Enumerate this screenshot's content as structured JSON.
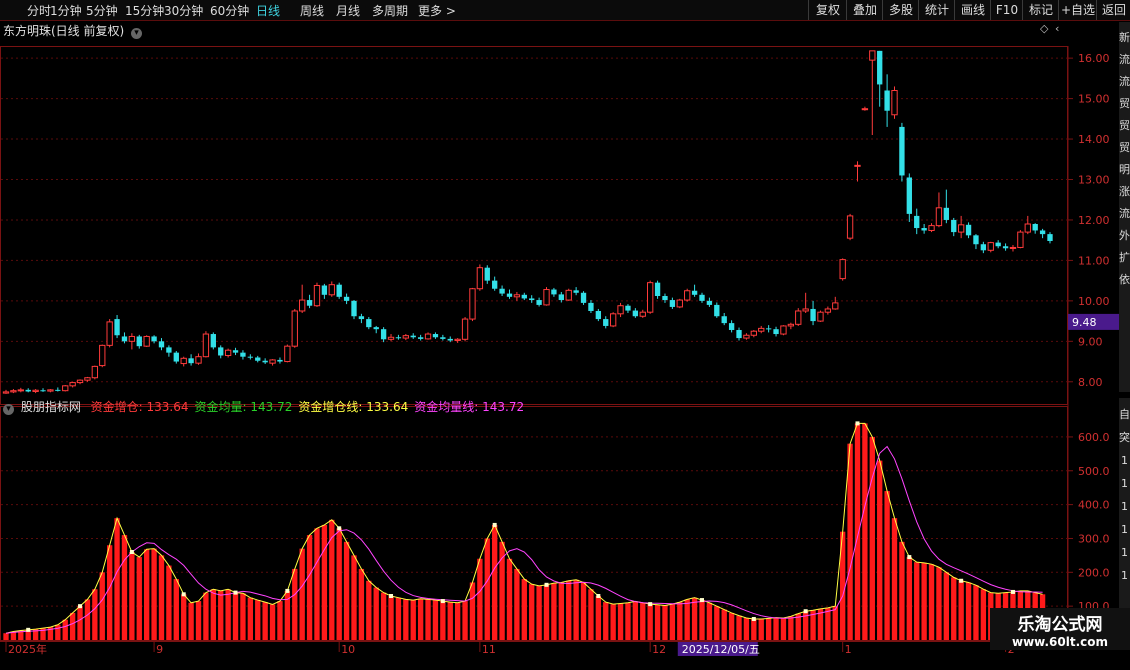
{
  "toolbar": {
    "left": [
      "分时",
      "1分钟",
      "5分钟",
      "15分钟",
      "30分钟",
      "60分钟",
      "日线",
      "周线",
      "月线",
      "多周期",
      "更多 >"
    ],
    "active": "日线",
    "right": [
      "复权",
      "叠加",
      "多股",
      "统计",
      "画线",
      "F10",
      "标记",
      "+自选",
      "返回"
    ]
  },
  "main": {
    "title": "东方明珠(日线 前复权)",
    "last_price": "9.48",
    "y_ticks": [
      "16.00",
      "15.00",
      "14.00",
      "13.00",
      "12.00",
      "11.00",
      "10.00",
      "9.00",
      "8.00"
    ]
  },
  "indicator": {
    "name": "股朋指标网",
    "items": [
      {
        "label": "资金增仓: 133.64",
        "color": "#ff3b3b"
      },
      {
        "label": "资金均量: 143.72",
        "color": "#29d129"
      },
      {
        "label": "资金增仓线: 133.64",
        "color": "#ffff44"
      },
      {
        "label": "资金均量线: 143.72",
        "color": "#ff44ff"
      }
    ],
    "y_ticks": [
      "600.0",
      "500.0",
      "400.0",
      "300.0",
      "200.0",
      "100.0"
    ]
  },
  "x_axis": {
    "labels": [
      {
        "text": "2025年",
        "i": 0
      },
      {
        "text": "9",
        "i": 20
      },
      {
        "text": "10",
        "i": 45
      },
      {
        "text": "11",
        "i": 64
      },
      {
        "text": "12",
        "i": 87
      },
      {
        "text": "2025/12/05/五",
        "i": 91
      },
      {
        "text": "1",
        "i": 113
      },
      {
        "text": "2",
        "i": 135
      }
    ],
    "highlight": "2025/12/05/五"
  },
  "right_panel_chars": [
    "新",
    "流",
    "流",
    "贸",
    "贸",
    "贸",
    "明",
    "涨",
    "流",
    "外",
    "扩",
    "依"
  ],
  "right_panel_chars_lower": [
    "自",
    "突",
    "1",
    "1",
    "1",
    "1",
    "1",
    "1"
  ],
  "watermark": {
    "line1": "乐淘公式网",
    "line2": "www.60lt.com"
  },
  "chart_data": [
    {
      "type": "candlestick",
      "title": "东方明珠(日线 前复权)",
      "ylim": [
        7.5,
        16.3
      ],
      "ohlc": [
        [
          7.72,
          7.8,
          7.7,
          7.75
        ],
        [
          7.75,
          7.82,
          7.72,
          7.78
        ],
        [
          7.78,
          7.85,
          7.74,
          7.8
        ],
        [
          7.8,
          7.84,
          7.74,
          7.76
        ],
        [
          7.76,
          7.82,
          7.72,
          7.79
        ],
        [
          7.79,
          7.84,
          7.75,
          7.77
        ],
        [
          7.77,
          7.82,
          7.74,
          7.8
        ],
        [
          7.8,
          7.86,
          7.76,
          7.78
        ],
        [
          7.78,
          7.92,
          7.76,
          7.9
        ],
        [
          7.9,
          8.0,
          7.86,
          7.98
        ],
        [
          7.98,
          8.06,
          7.94,
          8.04
        ],
        [
          8.04,
          8.12,
          8.0,
          8.1
        ],
        [
          8.1,
          8.4,
          8.06,
          8.38
        ],
        [
          8.4,
          8.92,
          8.36,
          8.9
        ],
        [
          8.9,
          9.55,
          8.85,
          9.48
        ],
        [
          9.55,
          9.65,
          9.08,
          9.15
        ],
        [
          9.12,
          9.22,
          8.95,
          9.0
        ],
        [
          9.0,
          9.2,
          8.8,
          9.12
        ],
        [
          9.12,
          9.16,
          8.82,
          8.88
        ],
        [
          8.88,
          9.15,
          8.86,
          9.12
        ],
        [
          9.12,
          9.15,
          8.95,
          9.0
        ],
        [
          9.0,
          9.08,
          8.78,
          8.85
        ],
        [
          8.85,
          8.9,
          8.62,
          8.72
        ],
        [
          8.72,
          8.76,
          8.45,
          8.5
        ],
        [
          8.45,
          8.62,
          8.38,
          8.58
        ],
        [
          8.58,
          8.68,
          8.4,
          8.46
        ],
        [
          8.46,
          8.7,
          8.42,
          8.62
        ],
        [
          8.62,
          9.25,
          8.6,
          9.18
        ],
        [
          9.18,
          9.22,
          8.8,
          8.85
        ],
        [
          8.85,
          8.9,
          8.58,
          8.65
        ],
        [
          8.65,
          8.82,
          8.6,
          8.78
        ],
        [
          8.78,
          8.84,
          8.66,
          8.72
        ],
        [
          8.72,
          8.78,
          8.55,
          8.62
        ],
        [
          8.62,
          8.68,
          8.55,
          8.6
        ],
        [
          8.6,
          8.64,
          8.48,
          8.52
        ],
        [
          8.52,
          8.58,
          8.44,
          8.48
        ],
        [
          8.46,
          8.56,
          8.4,
          8.54
        ],
        [
          8.54,
          8.6,
          8.45,
          8.5
        ],
        [
          8.5,
          8.92,
          8.48,
          8.88
        ],
        [
          8.88,
          9.8,
          8.84,
          9.75
        ],
        [
          9.75,
          10.4,
          9.7,
          10.02
        ],
        [
          10.02,
          10.15,
          9.82,
          9.88
        ],
        [
          9.88,
          10.45,
          9.85,
          10.38
        ],
        [
          10.38,
          10.42,
          10.05,
          10.15
        ],
        [
          10.15,
          10.48,
          10.1,
          10.4
        ],
        [
          10.4,
          10.45,
          10.05,
          10.1
        ],
        [
          10.1,
          10.18,
          9.92,
          10.0
        ],
        [
          10.0,
          10.02,
          9.55,
          9.62
        ],
        [
          9.62,
          9.68,
          9.45,
          9.55
        ],
        [
          9.55,
          9.6,
          9.3,
          9.35
        ],
        [
          9.35,
          9.38,
          9.2,
          9.3
        ],
        [
          9.3,
          9.35,
          8.98,
          9.05
        ],
        [
          9.05,
          9.18,
          9.0,
          9.1
        ],
        [
          9.1,
          9.16,
          9.04,
          9.08
        ],
        [
          9.08,
          9.18,
          9.03,
          9.14
        ],
        [
          9.14,
          9.2,
          9.06,
          9.1
        ],
        [
          9.1,
          9.16,
          9.02,
          9.06
        ],
        [
          9.06,
          9.22,
          9.04,
          9.18
        ],
        [
          9.18,
          9.22,
          9.06,
          9.1
        ],
        [
          9.1,
          9.16,
          9.02,
          9.06
        ],
        [
          9.06,
          9.12,
          8.98,
          9.02
        ],
        [
          9.02,
          9.08,
          8.96,
          9.05
        ],
        [
          9.05,
          9.6,
          9.0,
          9.55
        ],
        [
          9.55,
          10.32,
          9.5,
          10.3
        ],
        [
          10.3,
          10.9,
          10.25,
          10.82
        ],
        [
          10.82,
          10.88,
          10.42,
          10.5
        ],
        [
          10.5,
          10.6,
          10.25,
          10.3
        ],
        [
          10.3,
          10.38,
          10.12,
          10.18
        ],
        [
          10.18,
          10.28,
          10.05,
          10.1
        ],
        [
          10.1,
          10.22,
          10.0,
          10.15
        ],
        [
          10.15,
          10.2,
          10.02,
          10.06
        ],
        [
          10.06,
          10.14,
          9.95,
          10.02
        ],
        [
          10.02,
          10.08,
          9.86,
          9.9
        ],
        [
          9.9,
          10.34,
          9.88,
          10.28
        ],
        [
          10.28,
          10.32,
          10.1,
          10.16
        ],
        [
          10.16,
          10.22,
          9.96,
          10.02
        ],
        [
          10.02,
          10.3,
          10.0,
          10.26
        ],
        [
          10.26,
          10.34,
          10.14,
          10.2
        ],
        [
          10.2,
          10.24,
          9.9,
          9.95
        ],
        [
          9.95,
          10.02,
          9.7,
          9.75
        ],
        [
          9.75,
          9.8,
          9.5,
          9.55
        ],
        [
          9.55,
          9.62,
          9.32,
          9.38
        ],
        [
          9.38,
          9.72,
          9.35,
          9.68
        ],
        [
          9.68,
          9.95,
          9.6,
          9.88
        ],
        [
          9.88,
          9.92,
          9.7,
          9.76
        ],
        [
          9.76,
          9.82,
          9.58,
          9.62
        ],
        [
          9.62,
          9.78,
          9.58,
          9.72
        ],
        [
          9.72,
          10.5,
          9.68,
          10.45
        ],
        [
          10.45,
          10.5,
          10.05,
          10.12
        ],
        [
          10.12,
          10.18,
          9.95,
          10.02
        ],
        [
          10.02,
          10.08,
          9.8,
          9.85
        ],
        [
          9.85,
          10.05,
          9.82,
          10.02
        ],
        [
          10.02,
          10.3,
          9.98,
          10.25
        ],
        [
          10.25,
          10.4,
          10.1,
          10.15
        ],
        [
          10.15,
          10.2,
          9.95,
          10.0
        ],
        [
          10.0,
          10.08,
          9.85,
          9.9
        ],
        [
          9.9,
          9.96,
          9.58,
          9.62
        ],
        [
          9.62,
          9.7,
          9.4,
          9.45
        ],
        [
          9.45,
          9.52,
          9.22,
          9.28
        ],
        [
          9.28,
          9.34,
          9.02,
          9.08
        ],
        [
          9.08,
          9.2,
          9.04,
          9.15
        ],
        [
          9.15,
          9.28,
          9.1,
          9.25
        ],
        [
          9.25,
          9.38,
          9.2,
          9.32
        ],
        [
          9.32,
          9.4,
          9.22,
          9.3
        ],
        [
          9.3,
          9.36,
          9.12,
          9.18
        ],
        [
          9.18,
          9.4,
          9.15,
          9.38
        ],
        [
          9.38,
          9.46,
          9.3,
          9.42
        ],
        [
          9.42,
          9.82,
          9.38,
          9.75
        ],
        [
          9.75,
          10.2,
          9.7,
          9.8
        ],
        [
          9.8,
          10.0,
          9.4,
          9.5
        ],
        [
          9.5,
          9.76,
          9.48,
          9.72
        ],
        [
          9.72,
          9.86,
          9.66,
          9.8
        ],
        [
          9.8,
          10.1,
          9.78,
          9.95
        ],
        [
          10.55,
          11.05,
          10.5,
          11.02
        ],
        [
          11.55,
          12.15,
          11.5,
          12.1
        ],
        [
          13.35,
          13.45,
          12.95,
          13.35
        ],
        [
          14.75,
          14.8,
          14.7,
          14.75
        ],
        [
          15.95,
          16.18,
          14.1,
          16.18
        ],
        [
          16.18,
          16.18,
          14.8,
          15.35
        ],
        [
          15.2,
          15.6,
          14.3,
          14.7
        ],
        [
          14.6,
          15.3,
          14.5,
          15.2
        ],
        [
          14.3,
          14.4,
          12.95,
          13.1
        ],
        [
          13.05,
          13.15,
          11.95,
          12.15
        ],
        [
          12.1,
          12.28,
          11.65,
          11.8
        ],
        [
          11.8,
          11.9,
          11.66,
          11.74
        ],
        [
          11.74,
          11.92,
          11.7,
          11.86
        ],
        [
          11.86,
          12.68,
          11.82,
          12.3
        ],
        [
          12.3,
          12.75,
          11.92,
          12.0
        ],
        [
          12.0,
          12.05,
          11.6,
          11.7
        ],
        [
          11.7,
          12.1,
          11.55,
          11.88
        ],
        [
          11.88,
          11.94,
          11.55,
          11.62
        ],
        [
          11.62,
          11.65,
          11.28,
          11.4
        ],
        [
          11.4,
          11.46,
          11.18,
          11.25
        ],
        [
          11.25,
          11.46,
          11.2,
          11.44
        ],
        [
          11.44,
          11.5,
          11.3,
          11.35
        ],
        [
          11.35,
          11.42,
          11.24,
          11.3
        ],
        [
          11.3,
          11.38,
          11.22,
          11.32
        ],
        [
          11.32,
          11.75,
          11.3,
          11.7
        ],
        [
          11.7,
          12.1,
          11.65,
          11.9
        ],
        [
          11.9,
          11.92,
          11.66,
          11.74
        ],
        [
          11.74,
          11.78,
          11.55,
          11.65
        ],
        [
          11.65,
          11.7,
          11.42,
          11.48
        ]
      ]
    },
    {
      "type": "bar+line",
      "title": "股朋指标网",
      "ylim": [
        0,
        650
      ],
      "series": [
        {
          "name": "资金增仓",
          "color": "#ff2222",
          "values": [
            20,
            25,
            28,
            30,
            32,
            35,
            38,
            45,
            60,
            80,
            100,
            120,
            150,
            200,
            280,
            360,
            310,
            260,
            245,
            268,
            270,
            250,
            220,
            180,
            135,
            110,
            115,
            140,
            150,
            145,
            150,
            140,
            138,
            125,
            118,
            112,
            105,
            115,
            145,
            210,
            270,
            310,
            330,
            340,
            355,
            330,
            290,
            250,
            210,
            175,
            155,
            140,
            130,
            125,
            120,
            118,
            122,
            120,
            118,
            115,
            112,
            110,
            115,
            170,
            240,
            300,
            340,
            290,
            240,
            210,
            180,
            165,
            160,
            163,
            168,
            170,
            175,
            178,
            170,
            150,
            130,
            112,
            106,
            108,
            110,
            114,
            110,
            106,
            104,
            102,
            106,
            112,
            120,
            125,
            118,
            110,
            100,
            90,
            80,
            72,
            65,
            62,
            62,
            64,
            66,
            65,
            70,
            78,
            85,
            88,
            92,
            95,
            100,
            320,
            580,
            640,
            640,
            600,
            530,
            440,
            360,
            290,
            245,
            230,
            228,
            224,
            215,
            200,
            185,
            175,
            170,
            162,
            150,
            140,
            138,
            140,
            142,
            145,
            145,
            140,
            135
          ]
        }
      ]
    }
  ]
}
